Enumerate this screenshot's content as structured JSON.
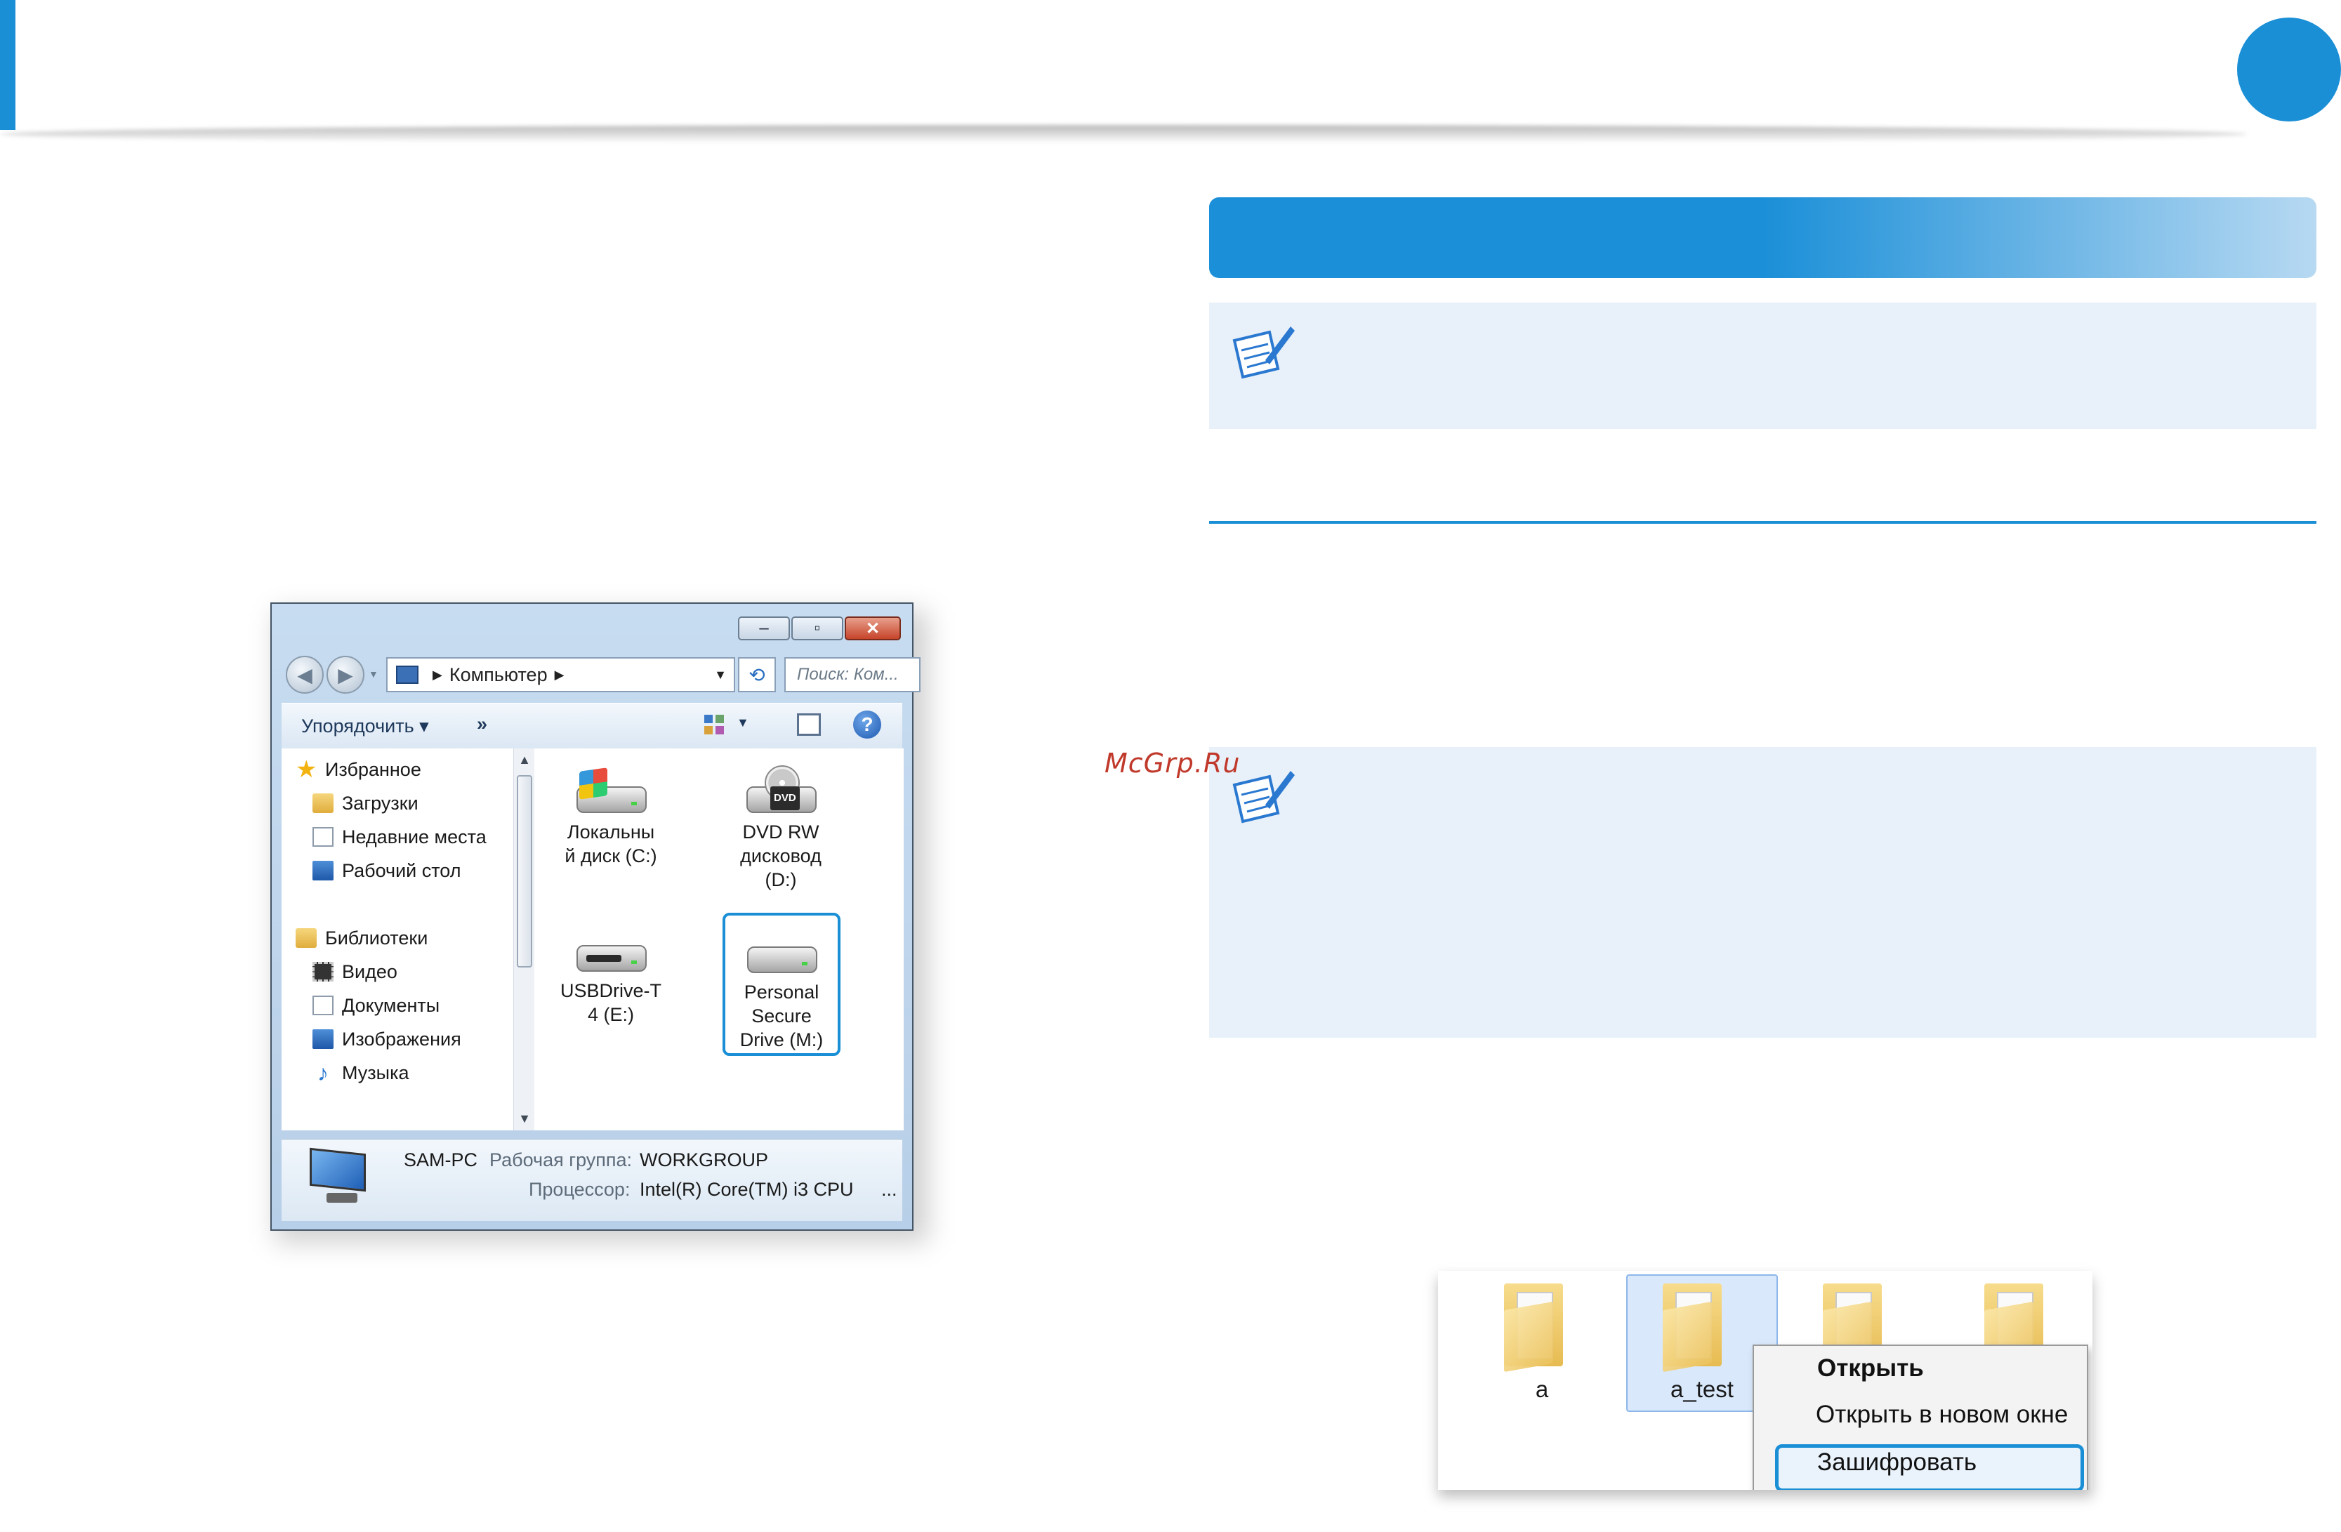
{
  "colors": {
    "accent": "#1a8fd6",
    "note_bg": "#e8f1fa",
    "watermark": "#c0392b"
  },
  "watermark": "McGrp.Ru",
  "explorer": {
    "window_buttons": {
      "minimize_icon": "minimize-icon",
      "maximize_icon": "maximize-icon",
      "close_icon": "close-icon"
    },
    "address": {
      "location": "Компьютер"
    },
    "search": {
      "placeholder": "Поиск: Ком..."
    },
    "toolbar": {
      "organize": "Упорядочить ▾",
      "more": "»"
    },
    "nav": {
      "favorites": "Избранное",
      "downloads": "Загрузки",
      "recent": "Недавние места",
      "desktop": "Рабочий стол",
      "libraries": "Библиотеки",
      "video": "Видео",
      "documents": "Документы",
      "images": "Изображения",
      "music": "Музыка"
    },
    "drives": [
      {
        "line1": "Локальны",
        "line2": "й диск (C:)",
        "line3": ""
      },
      {
        "line1": "DVD RW",
        "line2": "дисковод",
        "line3": "(D:)",
        "tag": "DVD"
      },
      {
        "line1": "USBDrive-T",
        "line2": "4 (E:)",
        "line3": ""
      },
      {
        "line1": "Personal",
        "line2": "Secure",
        "line3": "Drive (M:)"
      }
    ],
    "details": {
      "computer_name": "SAM-PC",
      "workgroup_label": "Рабочая группа:",
      "workgroup_value": "WORKGROUP",
      "cpu_label": "Процессор:",
      "cpu_value": "Intel(R) Core(TM) i3 CPU",
      "ellipsis": "..."
    }
  },
  "context_example": {
    "folders": [
      {
        "label": "a"
      },
      {
        "label": "a_test"
      }
    ],
    "menu": {
      "open": "Открыть",
      "open_new_window": "Открыть в новом окне",
      "encrypt": "Зашифровать"
    }
  }
}
